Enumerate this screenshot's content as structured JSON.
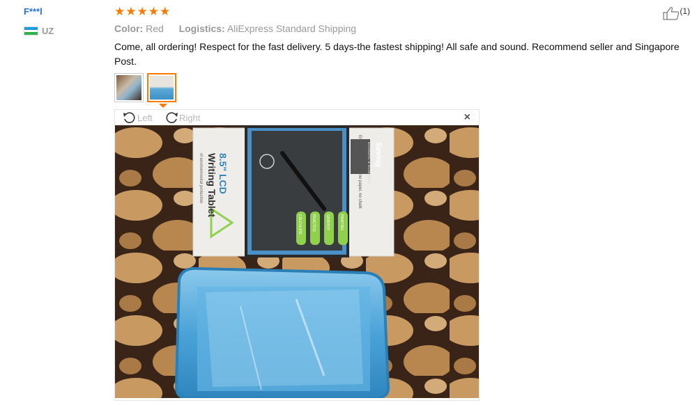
{
  "user": {
    "name": "F***l",
    "country": "UZ"
  },
  "review": {
    "stars": 5,
    "color_label": "Color:",
    "color_value": "Red",
    "logistics_label": "Logistics:",
    "logistics_value": "AliExpress Standard Shipping",
    "text": "Come, all ordering! Respect for the fast delivery. 5 days-the fastest shipping! All safe and sound. Recommend seller and Singapore Post.",
    "helpful_count": "(1)"
  },
  "viewer": {
    "left_label": "Left",
    "right_label": "Right",
    "close_label": "×",
    "packaging": {
      "size_label": "8.5\" LCD",
      "product_title": "Writing Tablet",
      "tagline": "of environmental protection",
      "badge_title": "Saving",
      "badge_sub": "economic & ecological",
      "features_text": "Environment-friendly  no paper, no chalk",
      "pill_labels": [
        "CALCULATE",
        "PRACTICE",
        "GRAFFITI",
        "PAINTING"
      ]
    }
  },
  "colors": {
    "accent": "#ff7a00",
    "username": "#2a6fd6",
    "meta": "#999999"
  }
}
